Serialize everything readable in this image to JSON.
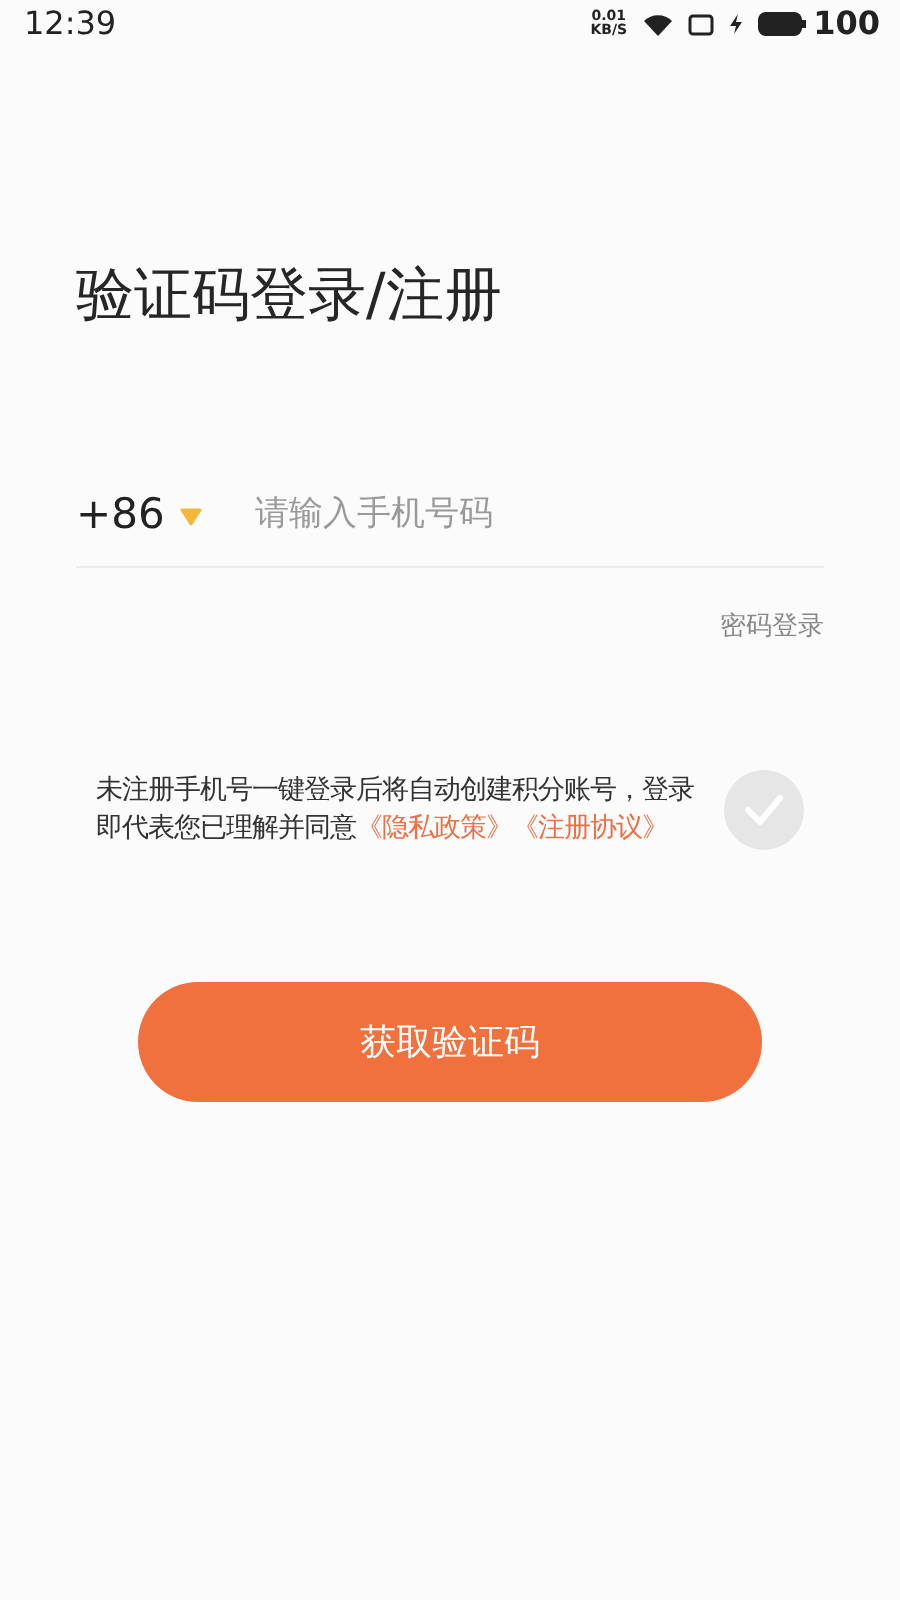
{
  "status_bar": {
    "time": "12:39",
    "net_speed": "0.01",
    "net_unit": "KB/S",
    "battery": "100"
  },
  "title": "验证码登录/注册",
  "phone": {
    "country_code": "+86",
    "placeholder": "请输入手机号码"
  },
  "password_login": "密码登录",
  "agreement": {
    "text": "未注册手机号一键登录后将自动创建积分账号，登录即代表您已理解并同意",
    "links": [
      "《隐私政策》",
      "《注册协议》"
    ],
    "checked": false
  },
  "submit": "获取验证码"
}
